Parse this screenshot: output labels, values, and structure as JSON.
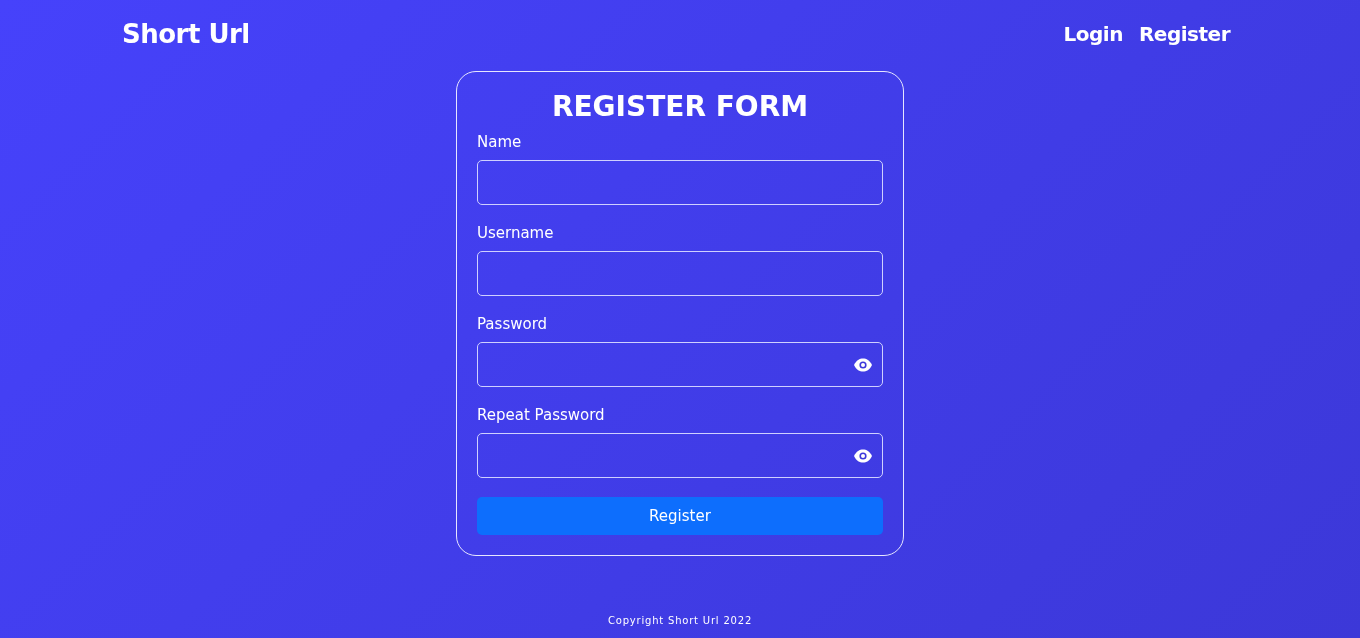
{
  "navbar": {
    "brand": "Short Url",
    "links": [
      "Login",
      "Register"
    ]
  },
  "form": {
    "title": "REGISTER FORM",
    "fields": [
      {
        "label": "Name",
        "kind": "text"
      },
      {
        "label": "Username",
        "kind": "text"
      },
      {
        "label": "Password",
        "kind": "password"
      },
      {
        "label": "Repeat Password",
        "kind": "password"
      }
    ],
    "submit": "Register"
  },
  "footer": "Copyright Short Url 2022"
}
